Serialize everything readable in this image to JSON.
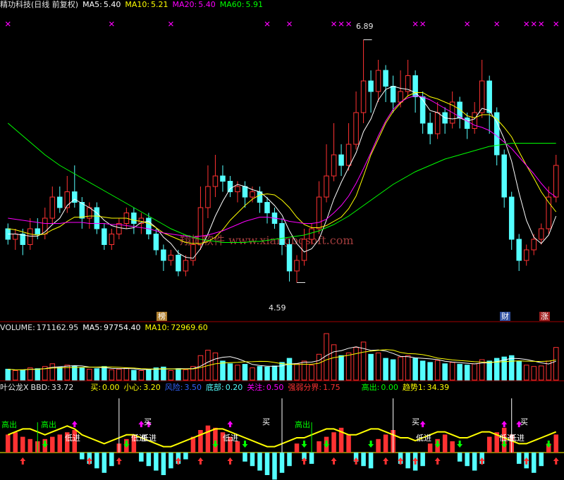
{
  "main": {
    "stock_name": "精功科技(日线 前复权)",
    "ma5_label": "MA5:",
    "ma5_value": "5.40",
    "ma10_label": "MA10:",
    "ma10_value": "5.21",
    "ma20_label": "MA20:",
    "ma20_value": "5.40",
    "ma60_label": "MA60:",
    "ma60_value": "5.91",
    "high_marker": "6.89",
    "low_marker": "4.59",
    "watermark": "翔博软件 www.xiangbosoft.com",
    "tags": [
      "榜",
      "财",
      "涨"
    ]
  },
  "volume": {
    "label": "VOLUME:",
    "value": "171162.95",
    "ma5_label": "MA5:",
    "ma5_value": "97754.40",
    "ma10_label": "MA10:",
    "ma10_value": "72969.60"
  },
  "indicator": {
    "name": "叶公龙X",
    "bbd_label": "BBD:",
    "bbd_value": "33.72",
    "buy_label": "买:",
    "buy_value": "0.00",
    "careful_label": "小心:",
    "careful_value": "3.20",
    "risk_label": "风险:",
    "risk_value": "3.50",
    "bottom_label": "底部:",
    "bottom_value": "0.20",
    "focus_label": "关注:",
    "focus_value": "0.50",
    "boundary_label": "强弱分界:",
    "boundary_value": "1.75",
    "sell_label": "高出:",
    "sell_value": "0.00",
    "trend_label": "趋势1:",
    "trend_value": "34.39",
    "signal_sell": "高出",
    "signal_low_in": "低进",
    "signal_buy": "买"
  },
  "colors": {
    "ma5": "#ffffff",
    "ma10": "#ffff00",
    "ma20": "#ff00ff",
    "ma60": "#00ff00",
    "up": "#ff3232",
    "down": "#54ffff"
  },
  "chart_data": {
    "type": "candlestick",
    "ylim": [
      4.4,
      7.0
    ],
    "candles": [
      [
        5.1,
        5.0,
        5.15,
        4.95
      ],
      [
        5.0,
        5.05,
        5.1,
        4.9
      ],
      [
        5.05,
        4.95,
        5.1,
        4.85
      ],
      [
        4.95,
        5.1,
        5.2,
        4.9
      ],
      [
        5.1,
        5.05,
        5.2,
        5.0
      ],
      [
        5.05,
        5.2,
        5.3,
        5.0
      ],
      [
        5.2,
        5.4,
        5.5,
        5.15
      ],
      [
        5.4,
        5.3,
        5.5,
        5.25
      ],
      [
        5.3,
        5.45,
        5.6,
        5.25
      ],
      [
        5.45,
        5.35,
        5.7,
        5.3
      ],
      [
        5.35,
        5.2,
        5.4,
        5.1
      ],
      [
        5.2,
        5.3,
        5.35,
        5.1
      ],
      [
        5.3,
        5.1,
        5.35,
        5.05
      ],
      [
        5.1,
        4.95,
        5.15,
        4.9
      ],
      [
        4.95,
        5.05,
        5.1,
        4.9
      ],
      [
        5.05,
        5.15,
        5.2,
        5.0
      ],
      [
        5.15,
        5.25,
        5.3,
        5.1
      ],
      [
        5.25,
        5.15,
        5.3,
        5.05
      ],
      [
        5.15,
        5.2,
        5.25,
        5.05
      ],
      [
        5.2,
        5.05,
        5.25,
        5.0
      ],
      [
        5.05,
        4.9,
        5.1,
        4.85
      ],
      [
        4.9,
        4.8,
        4.95,
        4.7
      ],
      [
        4.8,
        4.85,
        4.9,
        4.75
      ],
      [
        4.85,
        4.7,
        4.9,
        4.65
      ],
      [
        4.7,
        4.8,
        4.85,
        4.65
      ],
      [
        4.8,
        4.95,
        5.0,
        4.75
      ],
      [
        4.95,
        5.3,
        5.5,
        4.9
      ],
      [
        5.3,
        5.5,
        5.7,
        5.2
      ],
      [
        5.5,
        5.6,
        5.8,
        5.4
      ],
      [
        5.6,
        5.55,
        5.7,
        5.45
      ],
      [
        5.55,
        5.45,
        5.6,
        5.4
      ],
      [
        5.45,
        5.5,
        5.55,
        5.35
      ],
      [
        5.5,
        5.4,
        5.55,
        5.3
      ],
      [
        5.4,
        5.45,
        5.5,
        5.35
      ],
      [
        5.45,
        5.35,
        5.5,
        5.25
      ],
      [
        5.35,
        5.25,
        5.4,
        5.15
      ],
      [
        5.25,
        5.15,
        5.3,
        5.1
      ],
      [
        5.15,
        4.95,
        5.2,
        4.85
      ],
      [
        4.95,
        4.7,
        5.0,
        4.6
      ],
      [
        4.7,
        4.8,
        4.85,
        4.59
      ],
      [
        4.8,
        5.0,
        5.1,
        4.75
      ],
      [
        5.0,
        5.1,
        5.15,
        4.95
      ],
      [
        5.1,
        5.4,
        5.55,
        5.05
      ],
      [
        5.4,
        5.6,
        5.9,
        5.35
      ],
      [
        5.6,
        5.8,
        6.1,
        5.55
      ],
      [
        5.8,
        5.7,
        5.9,
        5.6
      ],
      [
        5.7,
        5.9,
        6.1,
        5.65
      ],
      [
        5.9,
        6.2,
        6.4,
        5.85
      ],
      [
        6.2,
        6.5,
        6.89,
        6.1
      ],
      [
        6.5,
        6.4,
        6.6,
        6.2
      ],
      [
        6.4,
        6.6,
        6.7,
        6.3
      ],
      [
        6.6,
        6.45,
        6.65,
        6.3
      ],
      [
        6.45,
        6.3,
        6.55,
        6.2
      ],
      [
        6.3,
        6.4,
        6.6,
        6.25
      ],
      [
        6.4,
        6.55,
        6.7,
        6.35
      ],
      [
        6.55,
        6.35,
        6.6,
        6.2
      ],
      [
        6.35,
        6.1,
        6.4,
        6.0
      ],
      [
        6.1,
        6.0,
        6.2,
        5.9
      ],
      [
        6.0,
        6.2,
        6.3,
        5.95
      ],
      [
        6.2,
        6.1,
        6.25,
        6.0
      ],
      [
        6.1,
        6.3,
        6.4,
        6.05
      ],
      [
        6.3,
        6.15,
        6.35,
        6.05
      ],
      [
        6.15,
        6.05,
        6.2,
        5.95
      ],
      [
        6.05,
        6.2,
        6.3,
        6.0
      ],
      [
        6.2,
        6.5,
        6.7,
        6.15
      ],
      [
        6.5,
        6.2,
        6.55,
        6.0
      ],
      [
        6.2,
        5.8,
        6.25,
        5.7
      ],
      [
        5.8,
        5.4,
        5.85,
        5.3
      ],
      [
        5.4,
        5.0,
        5.45,
        4.9
      ],
      [
        5.0,
        4.8,
        5.05,
        4.7
      ],
      [
        4.8,
        4.9,
        4.95,
        4.75
      ],
      [
        4.9,
        5.0,
        5.05,
        4.85
      ],
      [
        5.0,
        5.1,
        5.15,
        4.95
      ],
      [
        5.1,
        5.4,
        5.5,
        5.05
      ],
      [
        5.4,
        5.7,
        5.8,
        5.35
      ]
    ],
    "ma_series": [
      {
        "name": "MA5",
        "values": [
          5.05,
          5.05,
          5.04,
          5.03,
          5.03,
          5.07,
          5.14,
          5.2,
          5.32,
          5.38,
          5.34,
          5.3,
          5.25,
          5.18,
          5.13,
          5.11,
          5.1,
          5.11,
          5.16,
          5.17,
          5.11,
          5.02,
          4.96,
          4.87,
          4.83,
          4.82,
          4.91,
          5.05,
          5.22,
          5.36,
          5.48,
          5.52,
          5.5,
          5.47,
          5.45,
          5.39,
          5.32,
          5.23,
          5.08,
          4.96,
          4.88,
          4.91,
          5.0,
          5.18,
          5.38,
          5.54,
          5.68,
          5.82,
          6.02,
          6.14,
          6.32,
          6.42,
          6.45,
          6.43,
          6.42,
          6.39,
          6.32,
          6.22,
          6.2,
          6.15,
          6.14,
          6.15,
          6.12,
          6.14,
          6.24,
          6.22,
          6.11,
          5.95,
          5.74,
          5.44,
          5.18,
          5.02,
          4.96,
          5.04,
          5.22
        ]
      },
      {
        "name": "MA10",
        "values": [
          5.1,
          5.09,
          5.07,
          5.05,
          5.04,
          5.05,
          5.09,
          5.12,
          5.17,
          5.21,
          5.21,
          5.22,
          5.22,
          5.21,
          5.2,
          5.2,
          5.2,
          5.18,
          5.17,
          5.15,
          5.11,
          5.06,
          5.03,
          5.0,
          4.97,
          4.96,
          4.96,
          4.98,
          5.02,
          5.09,
          5.18,
          5.25,
          5.32,
          5.38,
          5.42,
          5.43,
          5.42,
          5.37,
          5.3,
          5.21,
          5.14,
          5.11,
          5.11,
          5.13,
          5.17,
          5.21,
          5.29,
          5.41,
          5.6,
          5.8,
          5.95,
          6.1,
          6.21,
          6.29,
          6.36,
          6.39,
          6.39,
          6.35,
          6.33,
          6.3,
          6.27,
          6.23,
          6.17,
          6.15,
          6.18,
          6.18,
          6.14,
          6.06,
          5.97,
          5.83,
          5.7,
          5.58,
          5.45,
          5.35,
          5.26
        ]
      },
      {
        "name": "MA20",
        "values": [
          5.2,
          5.19,
          5.18,
          5.17,
          5.16,
          5.15,
          5.15,
          5.15,
          5.16,
          5.16,
          5.16,
          5.15,
          5.15,
          5.15,
          5.14,
          5.14,
          5.13,
          5.12,
          5.11,
          5.1,
          5.08,
          5.06,
          5.05,
          5.04,
          5.03,
          5.02,
          5.03,
          5.04,
          5.06,
          5.08,
          5.11,
          5.14,
          5.17,
          5.19,
          5.21,
          5.21,
          5.2,
          5.19,
          5.17,
          5.16,
          5.15,
          5.15,
          5.16,
          5.19,
          5.25,
          5.32,
          5.41,
          5.53,
          5.67,
          5.82,
          5.98,
          6.12,
          6.23,
          6.3,
          6.34,
          6.36,
          6.35,
          6.32,
          6.28,
          6.24,
          6.2,
          6.16,
          6.12,
          6.08,
          6.06,
          6.03,
          5.98,
          5.92,
          5.86,
          5.78,
          5.7,
          5.62,
          5.53,
          5.45,
          5.4
        ]
      },
      {
        "name": "MA60",
        "values": [
          6.1,
          6.04,
          5.98,
          5.92,
          5.86,
          5.8,
          5.75,
          5.7,
          5.66,
          5.62,
          5.58,
          5.54,
          5.5,
          5.46,
          5.42,
          5.38,
          5.34,
          5.3,
          5.26,
          5.22,
          5.18,
          5.14,
          5.1,
          5.07,
          5.04,
          5.02,
          5.0,
          4.99,
          4.98,
          4.97,
          4.97,
          4.97,
          4.97,
          4.98,
          4.98,
          4.99,
          5.0,
          5.01,
          5.02,
          5.03,
          5.04,
          5.06,
          5.08,
          5.11,
          5.14,
          5.18,
          5.22,
          5.27,
          5.32,
          5.37,
          5.42,
          5.47,
          5.52,
          5.56,
          5.6,
          5.64,
          5.67,
          5.7,
          5.73,
          5.76,
          5.78,
          5.8,
          5.82,
          5.84,
          5.86,
          5.88,
          5.89,
          5.9,
          5.91,
          5.91,
          5.91,
          5.91,
          5.91,
          5.91,
          5.91
        ]
      }
    ],
    "volume": [
      [
        40,
        "d"
      ],
      [
        35,
        "u"
      ],
      [
        38,
        "d"
      ],
      [
        45,
        "u"
      ],
      [
        42,
        "d"
      ],
      [
        50,
        "u"
      ],
      [
        60,
        "u"
      ],
      [
        48,
        "d"
      ],
      [
        55,
        "u"
      ],
      [
        52,
        "d"
      ],
      [
        45,
        "d"
      ],
      [
        40,
        "u"
      ],
      [
        42,
        "d"
      ],
      [
        50,
        "d"
      ],
      [
        38,
        "u"
      ],
      [
        40,
        "u"
      ],
      [
        44,
        "u"
      ],
      [
        36,
        "d"
      ],
      [
        35,
        "u"
      ],
      [
        40,
        "d"
      ],
      [
        45,
        "d"
      ],
      [
        48,
        "d"
      ],
      [
        35,
        "u"
      ],
      [
        42,
        "d"
      ],
      [
        38,
        "u"
      ],
      [
        50,
        "u"
      ],
      [
        90,
        "u"
      ],
      [
        110,
        "u"
      ],
      [
        100,
        "u"
      ],
      [
        70,
        "d"
      ],
      [
        60,
        "d"
      ],
      [
        55,
        "u"
      ],
      [
        58,
        "d"
      ],
      [
        45,
        "u"
      ],
      [
        50,
        "d"
      ],
      [
        48,
        "d"
      ],
      [
        52,
        "d"
      ],
      [
        65,
        "d"
      ],
      [
        80,
        "d"
      ],
      [
        60,
        "u"
      ],
      [
        70,
        "u"
      ],
      [
        55,
        "u"
      ],
      [
        95,
        "u"
      ],
      [
        171,
        "u"
      ],
      [
        130,
        "u"
      ],
      [
        90,
        "d"
      ],
      [
        100,
        "u"
      ],
      [
        120,
        "u"
      ],
      [
        140,
        "u"
      ],
      [
        95,
        "d"
      ],
      [
        100,
        "u"
      ],
      [
        80,
        "d"
      ],
      [
        75,
        "d"
      ],
      [
        85,
        "u"
      ],
      [
        90,
        "u"
      ],
      [
        80,
        "d"
      ],
      [
        70,
        "d"
      ],
      [
        65,
        "d"
      ],
      [
        72,
        "u"
      ],
      [
        60,
        "d"
      ],
      [
        65,
        "u"
      ],
      [
        58,
        "d"
      ],
      [
        55,
        "d"
      ],
      [
        60,
        "u"
      ],
      [
        75,
        "u"
      ],
      [
        70,
        "d"
      ],
      [
        80,
        "d"
      ],
      [
        85,
        "d"
      ],
      [
        90,
        "d"
      ],
      [
        70,
        "d"
      ],
      [
        55,
        "u"
      ],
      [
        50,
        "u"
      ],
      [
        52,
        "u"
      ],
      [
        70,
        "u"
      ],
      [
        120,
        "u"
      ]
    ],
    "bbd_bars": [
      8,
      9,
      7,
      6,
      5,
      6,
      7,
      8,
      9,
      10,
      -3,
      -5,
      -7,
      -9,
      -6,
      4,
      6,
      8,
      -4,
      -6,
      -8,
      -10,
      -7,
      -5,
      -3,
      7,
      10,
      12,
      11,
      9,
      7,
      5,
      -4,
      -6,
      -8,
      -10,
      -12,
      -9,
      -6,
      4,
      -3,
      -5,
      5,
      7,
      9,
      11,
      8,
      -4,
      -6,
      -7,
      6,
      8,
      10,
      -5,
      -7,
      -8,
      -6,
      4,
      6,
      8,
      5,
      -4,
      -6,
      -8,
      -5,
      7,
      9,
      11,
      8,
      -5,
      -7,
      -9,
      -6,
      4,
      8
    ],
    "trend_line": [
      6,
      7,
      8,
      8,
      7,
      6,
      7,
      8,
      9,
      8,
      6,
      5,
      4,
      3,
      4,
      5,
      6,
      6,
      5,
      4,
      3,
      2,
      2,
      3,
      4,
      5,
      6,
      7,
      8,
      8,
      7,
      6,
      5,
      4,
      3,
      2,
      2,
      3,
      4,
      5,
      5,
      6,
      7,
      8,
      8,
      7,
      6,
      6,
      7,
      8,
      8,
      7,
      6,
      5,
      5,
      4,
      5,
      6,
      7,
      7,
      6,
      5,
      5,
      6,
      7,
      7,
      6,
      5,
      4,
      3,
      3,
      4,
      5,
      6,
      7
    ]
  }
}
